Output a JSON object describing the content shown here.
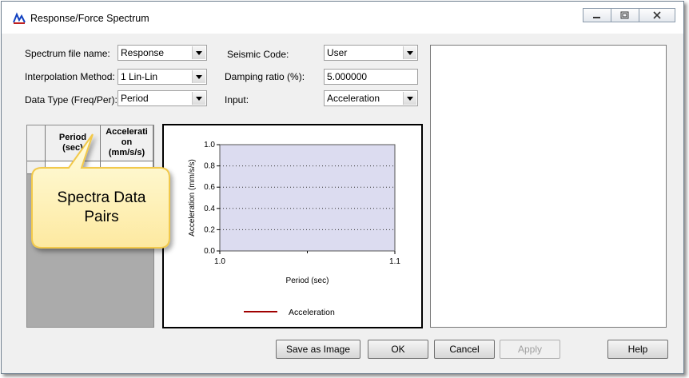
{
  "window": {
    "title": "Response/Force Spectrum"
  },
  "form": {
    "spectrum_file_label": "Spectrum file name:",
    "spectrum_file_value": "Response",
    "interpolation_label": "Interpolation Method:",
    "interpolation_value": "1 Lin-Lin",
    "data_type_label": "Data Type (Freq/Per):",
    "data_type_value": "Period",
    "seismic_code_label": "Seismic Code:",
    "seismic_code_value": "User",
    "damping_label": "Damping ratio (%):",
    "damping_value": "5.000000",
    "input_label": "Input:",
    "input_value": "Acceleration"
  },
  "table": {
    "col1_line1": "Period",
    "col1_line2": "(sec)",
    "col2_line1": "Accelerati",
    "col2_line2": "on",
    "col2_line3": "(mm/s/s)"
  },
  "callout": {
    "line1": "Spectra Data",
    "line2": "Pairs"
  },
  "chart_data": {
    "type": "line",
    "xlabel": "Period (sec)",
    "ylabel": "Acceleration (mm/s/s)",
    "xlim": [
      1.0,
      1.1
    ],
    "ylim": [
      0.0,
      1.0
    ],
    "x_ticks": [
      "1.0",
      "1.1"
    ],
    "y_ticks": [
      "0.0",
      "0.2",
      "0.4",
      "0.6",
      "0.8",
      "1.0"
    ],
    "grid": "horizontal dotted",
    "plot_background": "#dcdcf0",
    "series": [
      {
        "name": "Acceleration",
        "color": "#a00000",
        "x": [],
        "y": []
      }
    ],
    "legend": "bottom-center"
  },
  "buttons": {
    "save_image": "Save as Image",
    "ok": "OK",
    "cancel": "Cancel",
    "apply": "Apply",
    "help": "Help"
  }
}
